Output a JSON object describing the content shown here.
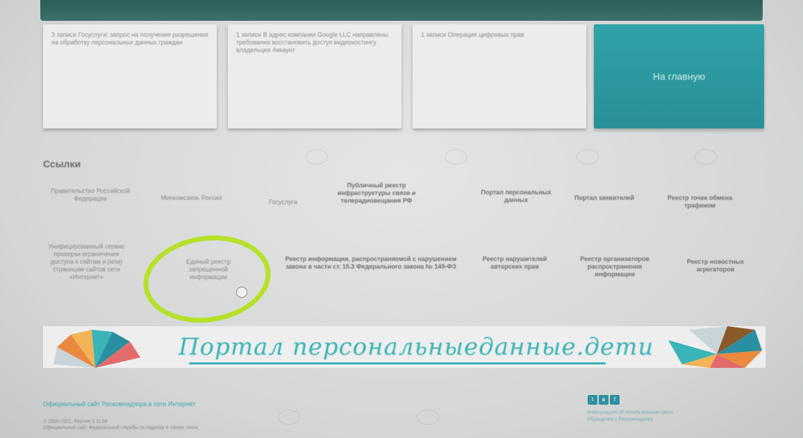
{
  "cards": [
    {
      "text": "3 записи Госуслуги: запрос на получение разрешения на обработку персональных данных граждан"
    },
    {
      "text": "1 записи В адрес компании Google LLC направлены требования восстановить доступ видеохостингу владельцев Аккаунт"
    },
    {
      "text": "1 записи Операция цифровых прав"
    }
  ],
  "main_button": {
    "label": "На главную"
  },
  "links_title": "Ссылки",
  "links_row1": [
    {
      "label": "Правительство Российской Федерации"
    },
    {
      "label": "Минкомсвязь России"
    },
    {
      "label": "Госуслуги"
    },
    {
      "label": "Публичный реестр инфраструктуры связи и телерадиовещания РФ"
    },
    {
      "label": "Портал персональных данных"
    },
    {
      "label": "Портал заявителей"
    },
    {
      "label": "Реестр точек обмена трафиком"
    }
  ],
  "links_row2": [
    {
      "label": "Унифицированный сервис проверки ограничения доступа к сайтам и (или) страницам сайтов сети «Интернет»"
    },
    {
      "label": "Единый реестр запрещенной информации"
    },
    {
      "label": "Реестр информации, распространяемой с нарушением закона в части ст. 15.3 Федерального закона № 149-ФЗ"
    },
    {
      "label": "Реестр нарушителей авторских прав"
    },
    {
      "label": "Реестр организаторов распространения информации"
    },
    {
      "label": "Реестр новостных агрегаторов"
    }
  ],
  "banner": {
    "text": "Портал персональныеданные.дети"
  },
  "footer": {
    "link": "Официальный сайт Роскомнадзора в сети Интернет",
    "copyright": "© 2009-2021, Версия 3.11.58",
    "official": "Официальный сайт Федеральной службы по надзору в сфере связи",
    "right_1": "Информация об использовании сайта",
    "right_2": "Обращения к Роскомнадзору"
  },
  "social": [
    "twitter-icon",
    "vk-icon",
    "facebook-icon"
  ],
  "colors": {
    "accent": "#2a9aa0",
    "highlight": "#b6e12a"
  }
}
